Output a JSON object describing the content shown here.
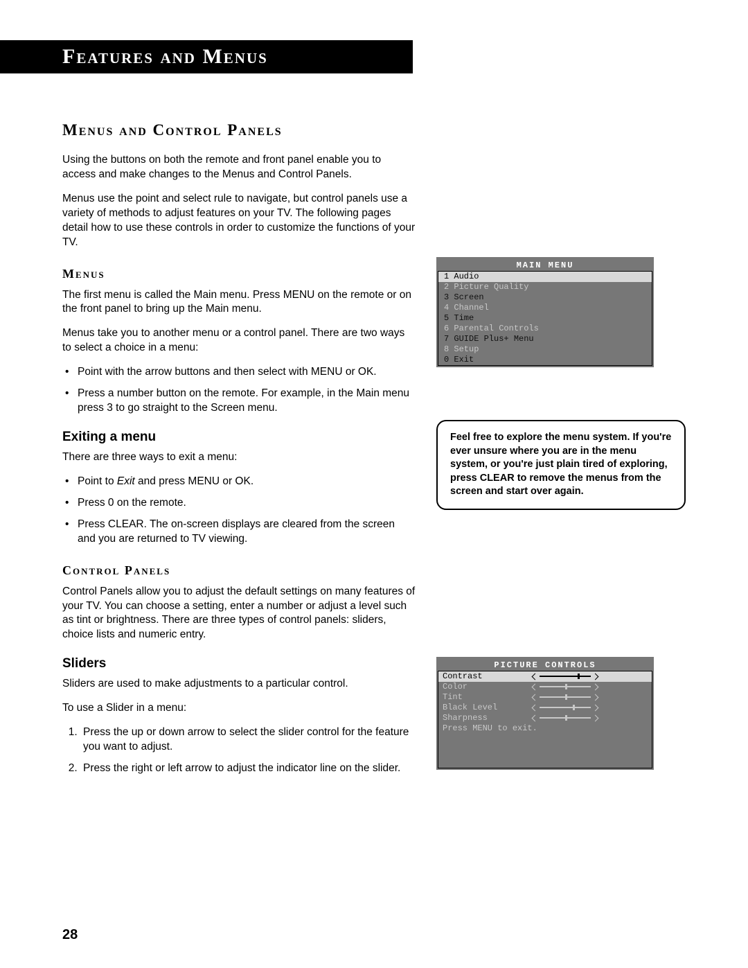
{
  "header": "Features and Menus",
  "section_title": "Menus and Control Panels",
  "intro_p1": "Using the buttons on both the remote and front panel enable you to access and make changes to the Menus and Control Panels.",
  "intro_p2": "Menus use the point and select rule to navigate, but control panels use a variety of methods to adjust features on your TV. The following pages detail how to use these controls in order to customize the functions of your TV.",
  "menus_heading": "Menus",
  "menus_p1": "The first menu is called the Main menu. Press MENU on the remote or on the front panel to bring up the Main menu.",
  "menus_p2": "Menus take you to another menu or a control panel. There are two ways to select a choice in a menu:",
  "menus_bullets": {
    "b1": "Point with the arrow buttons and then select with MENU or OK.",
    "b2": "Press a number button on the remote. For example, in the Main menu press 3 to go straight to the Screen menu."
  },
  "exiting_heading": "Exiting a menu",
  "exiting_p": "There are three ways to exit a menu:",
  "exiting_bullets": {
    "b1a": "Point to ",
    "b1b": "Exit",
    "b1c": " and press MENU or OK.",
    "b2": "Press 0 on the remote.",
    "b3": "Press CLEAR. The on-screen displays are cleared from the screen and you are returned to TV viewing."
  },
  "cp_heading": "Control Panels",
  "cp_p": "Control Panels allow you to adjust the default settings on many features of your TV. You can choose a setting, enter a number or adjust a level such as tint or brightness. There are three types of control panels: sliders, choice lists and numeric entry.",
  "sliders_heading": "Sliders",
  "sliders_p1": "Sliders are used to make adjustments to a particular control.",
  "sliders_p2": "To use a Slider in a menu:",
  "sliders_steps": {
    "s1": "Press the up or down arrow to select the slider control for the feature you want to adjust.",
    "s2": "Press the right or left arrow to adjust the indicator line on the slider."
  },
  "main_menu": {
    "title": "MAIN MENU",
    "items": {
      "i1": "1 Audio",
      "i2": "2 Picture Quality",
      "i3": "3 Screen",
      "i4": "4 Channel",
      "i5": "5 Time",
      "i6": "6 Parental Controls",
      "i7": "7 GUIDE Plus+ Menu",
      "i8": "8 Setup",
      "i0": "0 Exit"
    }
  },
  "tip": "Feel free to explore the menu system. If you're ever unsure where you are in the menu system, or you're just plain tired of exploring, press CLEAR to remove the menus from the screen and start over again.",
  "pic_controls": {
    "title": "PICTURE CONTROLS",
    "rows": {
      "r1": "Contrast",
      "r2": "Color",
      "r3": "Tint",
      "r4": "Black Level",
      "r5": "Sharpness"
    },
    "footer": "Press MENU to exit.",
    "slider_positions": {
      "r1": 55,
      "r2": 37,
      "r3": 37,
      "r4": 48,
      "r5": 37
    }
  },
  "page_number": "28"
}
